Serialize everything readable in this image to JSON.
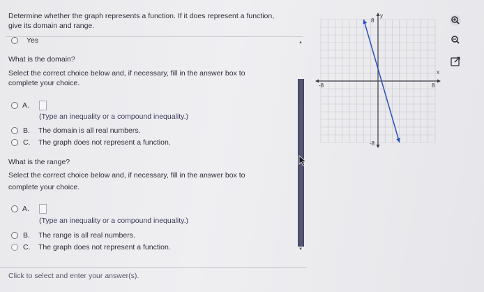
{
  "question": {
    "line1": "Determine whether the graph represents a function. If it does represent a function,",
    "line2": "give its domain and range."
  },
  "yes_answer": "Yes",
  "domain": {
    "heading": "What is the domain?",
    "instruction1": "Select the correct choice below and, if necessary, fill in the answer box to",
    "instruction2": "complete your choice.",
    "choice_a_letter": "A.",
    "choice_a_hint": "(Type an inequality or a compound inequality.)",
    "choice_b_letter": "B.",
    "choice_b_text": "The domain is all real numbers.",
    "choice_c_letter": "C.",
    "choice_c_text": "The graph does not represent a function."
  },
  "range": {
    "heading": "What is the range?",
    "instruction1": "Select the correct choice below and, if necessary, fill in the answer box to",
    "instruction2": "complete your choice.",
    "choice_a_letter": "A.",
    "choice_a_hint": "(Type an inequality or a compound inequality.)",
    "choice_b_letter": "B.",
    "choice_b_text": "The range is all real numbers.",
    "choice_c_letter": "C.",
    "choice_c_text": "The graph does not represent a function."
  },
  "footer": "Click to select and enter your answer(s).",
  "graph": {
    "y_axis_label": "y",
    "x_axis_label": "x",
    "y_max_label": "8",
    "y_min_label": "-8",
    "x_max_label": "8",
    "x_min_label": "-8",
    "line_color": "#2a4fb8",
    "x_range": [
      -8,
      8
    ],
    "y_range": [
      -8,
      8
    ],
    "line_start": {
      "x": -2,
      "y": 8
    },
    "line_end": {
      "x": 3,
      "y": -8
    }
  },
  "tools": [
    "zoom-in-icon",
    "zoom-out-icon",
    "popout-icon"
  ]
}
